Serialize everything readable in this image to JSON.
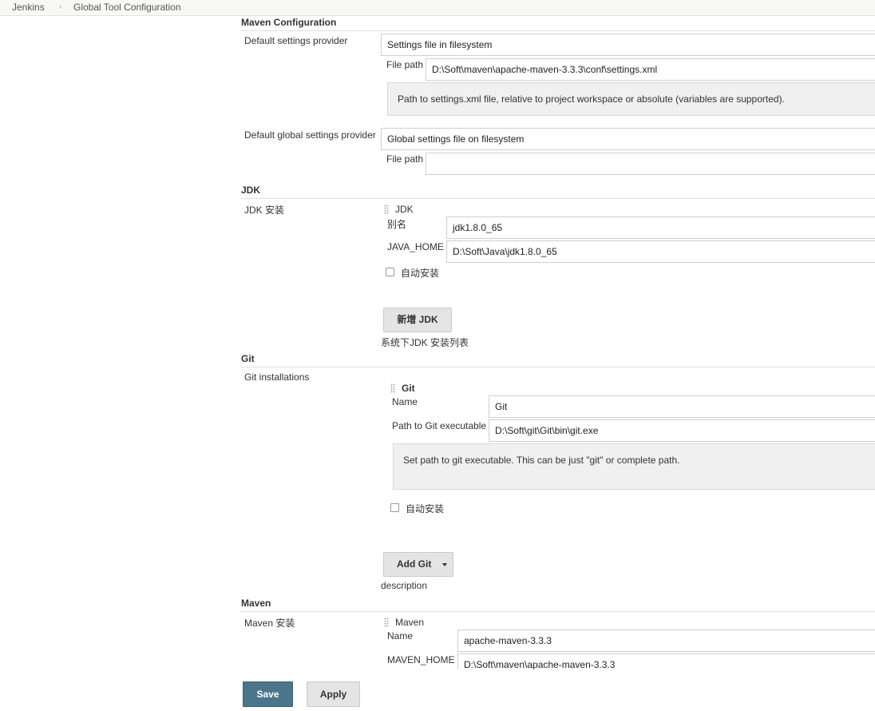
{
  "breadcrumb": {
    "items": [
      "Jenkins",
      "Global Tool Configuration"
    ]
  },
  "maven_config": {
    "title": "Maven Configuration",
    "default_settings_label": "Default settings provider",
    "default_settings_value": "Settings file in filesystem",
    "file_path_label": "File path",
    "file_path_value": "D:\\Soft\\maven\\apache-maven-3.3.3\\conf\\settings.xml",
    "file_path_help": "Path to settings.xml file, relative to project workspace or absolute (variables are supported).",
    "global_settings_label": "Default global settings provider",
    "global_settings_value": "Global settings file on filesystem",
    "global_file_path_label": "File path",
    "global_file_path_value": ""
  },
  "jdk": {
    "title": "JDK",
    "install_label": "JDK 安装",
    "item_header": "JDK",
    "alias_label": "别名",
    "alias_value": "jdk1.8.0_65",
    "java_home_label": "JAVA_HOME",
    "java_home_value": "D:\\Soft\\Java\\jdk1.8.0_65",
    "auto_install_label": "自动安装",
    "add_button": "新增 JDK",
    "list_description": "系统下JDK 安装列表"
  },
  "git": {
    "title": "Git",
    "install_label": "Git installations",
    "item_header": "Git",
    "name_label": "Name",
    "name_value": "Git",
    "path_label": "Path to Git executable",
    "path_value": "D:\\Soft\\git\\Git\\bin\\git.exe",
    "path_help": "Set path to git executable. This can be just \"git\" or complete path.",
    "auto_install_label": "自动安装",
    "add_button": "Add Git",
    "description": "description"
  },
  "maven": {
    "title": "Maven",
    "install_label": "Maven 安装",
    "item_header": "Maven",
    "name_label": "Name",
    "name_value": "apache-maven-3.3.3",
    "home_label": "MAVEN_HOME",
    "home_value": "D:\\Soft\\maven\\apache-maven-3.3.3"
  },
  "footer": {
    "save_label": "Save",
    "apply_label": "Apply"
  },
  "colors": {
    "primary_button": "#4b758b",
    "help_background": "#f0f0f0"
  }
}
